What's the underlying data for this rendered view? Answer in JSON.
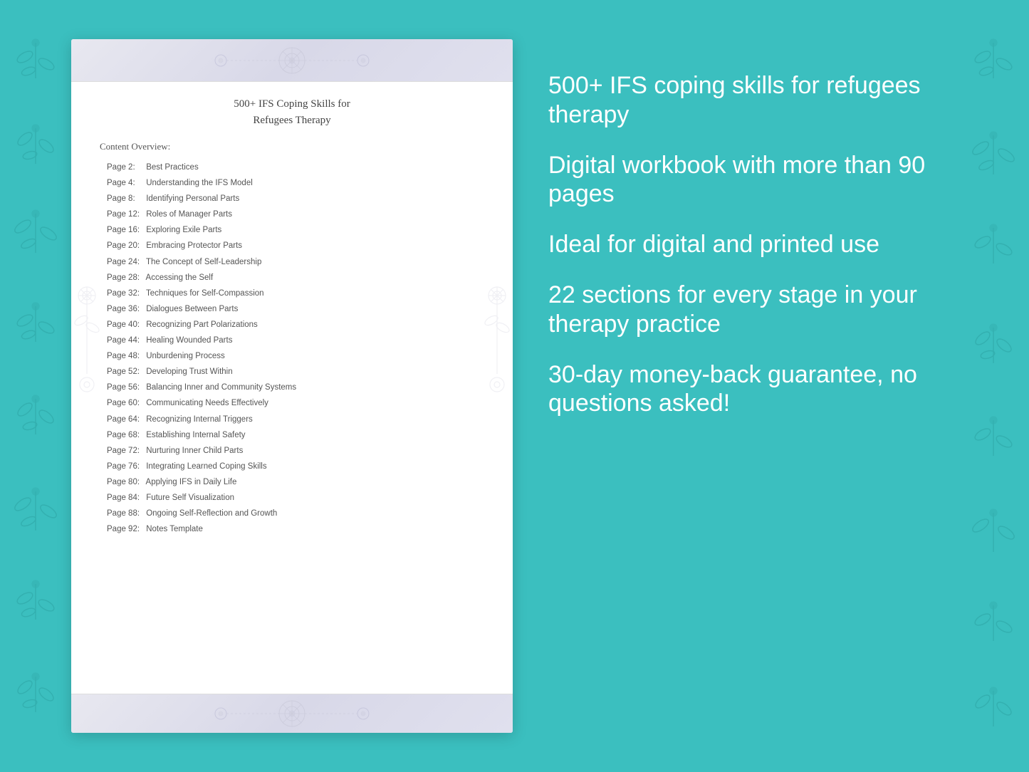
{
  "background_color": "#3bbfbf",
  "document": {
    "title_line1": "500+ IFS Coping Skills for",
    "title_line2": "Refugees Therapy",
    "content_overview_label": "Content Overview:",
    "toc_items": [
      {
        "page": "Page  2:",
        "topic": "Best Practices"
      },
      {
        "page": "Page  4:",
        "topic": "Understanding the IFS Model"
      },
      {
        "page": "Page  8:",
        "topic": "Identifying Personal Parts"
      },
      {
        "page": "Page 12:",
        "topic": "Roles of Manager Parts"
      },
      {
        "page": "Page 16:",
        "topic": "Exploring Exile Parts"
      },
      {
        "page": "Page 20:",
        "topic": "Embracing Protector Parts"
      },
      {
        "page": "Page 24:",
        "topic": "The Concept of Self-Leadership"
      },
      {
        "page": "Page 28:",
        "topic": "Accessing the Self"
      },
      {
        "page": "Page 32:",
        "topic": "Techniques for Self-Compassion"
      },
      {
        "page": "Page 36:",
        "topic": "Dialogues Between Parts"
      },
      {
        "page": "Page 40:",
        "topic": "Recognizing Part Polarizations"
      },
      {
        "page": "Page 44:",
        "topic": "Healing Wounded Parts"
      },
      {
        "page": "Page 48:",
        "topic": "Unburdening Process"
      },
      {
        "page": "Page 52:",
        "topic": "Developing Trust Within"
      },
      {
        "page": "Page 56:",
        "topic": "Balancing Inner and Community Systems"
      },
      {
        "page": "Page 60:",
        "topic": "Communicating Needs Effectively"
      },
      {
        "page": "Page 64:",
        "topic": "Recognizing Internal Triggers"
      },
      {
        "page": "Page 68:",
        "topic": "Establishing Internal Safety"
      },
      {
        "page": "Page 72:",
        "topic": "Nurturing Inner Child Parts"
      },
      {
        "page": "Page 76:",
        "topic": "Integrating Learned Coping Skills"
      },
      {
        "page": "Page 80:",
        "topic": "Applying IFS in Daily Life"
      },
      {
        "page": "Page 84:",
        "topic": "Future Self Visualization"
      },
      {
        "page": "Page 88:",
        "topic": "Ongoing Self-Reflection and Growth"
      },
      {
        "page": "Page 92:",
        "topic": "Notes Template"
      }
    ]
  },
  "features": [
    "500+ IFS coping skills for refugees therapy",
    "Digital workbook with more than 90 pages",
    "Ideal for digital and printed use",
    "22 sections for every stage in your therapy practice",
    "30-day money-back guarantee, no questions asked!"
  ]
}
